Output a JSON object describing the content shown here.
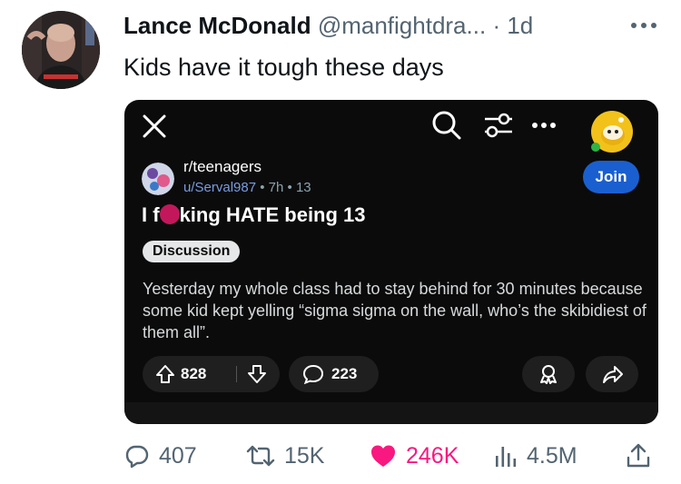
{
  "tweet": {
    "display_name": "Lance McDonald",
    "handle": "@manfightdra...",
    "separator": "·",
    "time": "1d",
    "text": "Kids have it tough these days"
  },
  "embed": {
    "subreddit": "r/teenagers",
    "username": "u/Serval987",
    "post_age": "7h",
    "meta_dot": "•",
    "post_score": "13",
    "join_label": "Join",
    "title_prefix": "I f",
    "title_suffix": "king HATE being 13",
    "flair": "Discussion",
    "body": "Yesterday my whole class had to stay behind for 30 minutes because some kid kept yelling “sigma sigma on the wall, who’s the skibidiest of them all”.",
    "upvotes": "828",
    "comments": "223"
  },
  "actions": {
    "replies": "407",
    "retweets": "15K",
    "likes": "246K",
    "views": "4.5M"
  },
  "colors": {
    "like_pink": "#f91880",
    "card_bg": "#0b0b0b",
    "join_blue": "#1a5fd0",
    "reddit_yellow": "#f2c21a"
  }
}
